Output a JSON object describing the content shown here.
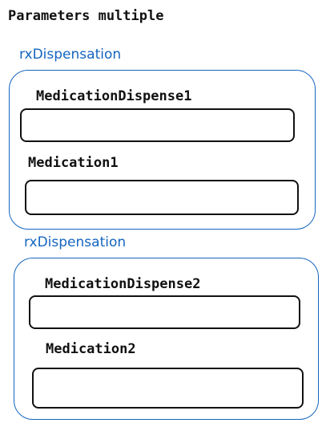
{
  "title": "Parameters multiple",
  "colors": {
    "group_border": "#1565c0",
    "group_label": "#1565c0",
    "field_border": "#111111",
    "text": "#111111"
  },
  "groups": [
    {
      "label": "rxDispensation",
      "fields": [
        {
          "label": "MedicationDispense1",
          "value": ""
        },
        {
          "label": "Medication1",
          "value": ""
        }
      ]
    },
    {
      "label": "rxDispensation",
      "fields": [
        {
          "label": "MedicationDispense2",
          "value": ""
        },
        {
          "label": "Medication2",
          "value": ""
        }
      ]
    }
  ]
}
